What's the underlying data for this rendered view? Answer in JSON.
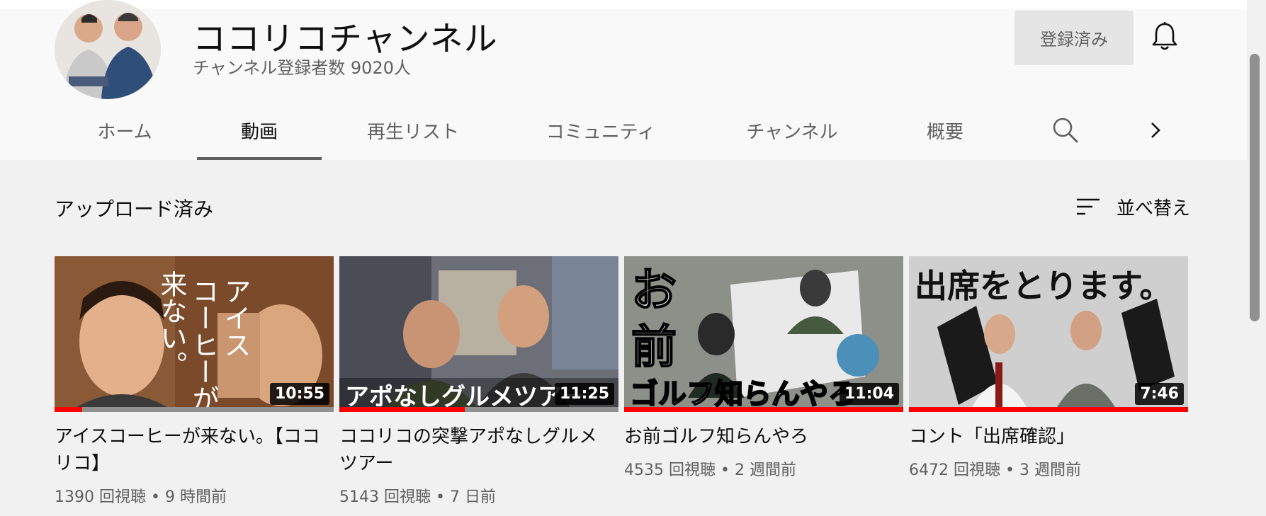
{
  "channel": {
    "name": "ココリコチャンネル",
    "subscribers": "チャンネル登録者数 9020人",
    "subscribed_label": "登録済み"
  },
  "tabs": [
    {
      "label": "ホーム",
      "active": false
    },
    {
      "label": "動画",
      "active": true
    },
    {
      "label": "再生リスト",
      "active": false
    },
    {
      "label": "コミュニティ",
      "active": false
    },
    {
      "label": "チャンネル",
      "active": false
    },
    {
      "label": "概要",
      "active": false
    }
  ],
  "section": {
    "title": "アップロード済み",
    "sort_label": "並べ替え"
  },
  "videos": [
    {
      "title": "アイスコーヒーが来ない。【ココリコ】",
      "duration": "10:55",
      "views": "1390 回視聴",
      "age": "9 時間前",
      "progress": 0.1,
      "thumb_text": "アイスコーヒーが来ない。"
    },
    {
      "title": "ココリコの突撃アポなしグルメツアー",
      "duration": "11:25",
      "views": "5143 回視聴",
      "age": "7 日前",
      "progress": 0.45,
      "thumb_text": "アポなしグルメツアー"
    },
    {
      "title": "お前ゴルフ知らんやろ",
      "duration": "11:04",
      "views": "4535 回視聴",
      "age": "2 週間前",
      "progress": 1.0,
      "thumb_text": "お前 ゴルフ知らんやろ"
    },
    {
      "title": "コント「出席確認」",
      "duration": "7:46",
      "views": "6472 回視聴",
      "age": "3 週間前",
      "progress": 1.0,
      "thumb_text": "出席をとります。"
    }
  ],
  "icons": {
    "bell": "bell-icon",
    "search": "search-icon",
    "next": "chevron-right-icon",
    "sort": "sort-icon"
  },
  "colors": {
    "progress": "#ff0000",
    "subscribed_bg": "#e5e5e5",
    "header_bg": "#f9f9f9",
    "page_bg": "#f1f1f1"
  }
}
